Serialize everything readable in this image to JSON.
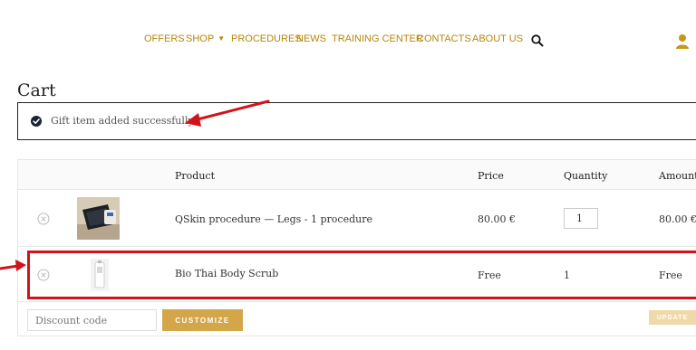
{
  "nav": {
    "items": [
      {
        "label": "OFFERS"
      },
      {
        "label": "SHOP",
        "dropdown": "chevron-down-icon"
      },
      {
        "label": "PROCEDURES"
      },
      {
        "label": "NEWS"
      },
      {
        "label": "TRAINING CENTER"
      },
      {
        "label": "CONTACTS"
      },
      {
        "label": "ABOUT US"
      }
    ],
    "search_icon": "search-icon",
    "account_icon": "user-icon",
    "accent_color": "#b8860b"
  },
  "page": {
    "title": "Cart"
  },
  "notice": {
    "icon": "check-circle-icon",
    "text": "Gift item added successfully"
  },
  "table": {
    "headers": {
      "product": "Product",
      "price": "Price",
      "quantity": "Quantity",
      "amount": "Amount"
    },
    "rows": [
      {
        "thumbnail": "device-procedure-image",
        "product": "QSkin procedure — Legs - 1 procedure",
        "price": "80.00 €",
        "quantity": "1",
        "quantity_editable": true,
        "amount": "80.00 €"
      },
      {
        "thumbnail": "scrub-bottle-image",
        "product": "Bio Thai Body Scrub",
        "price": "Free",
        "quantity": "1",
        "quantity_editable": false,
        "amount": "Free"
      }
    ]
  },
  "actions": {
    "discount_placeholder": "Discount code",
    "customize_label": "CUSTOMIZE",
    "update_label": "UPDATE"
  },
  "annotations": {
    "color": "#d3121a"
  }
}
